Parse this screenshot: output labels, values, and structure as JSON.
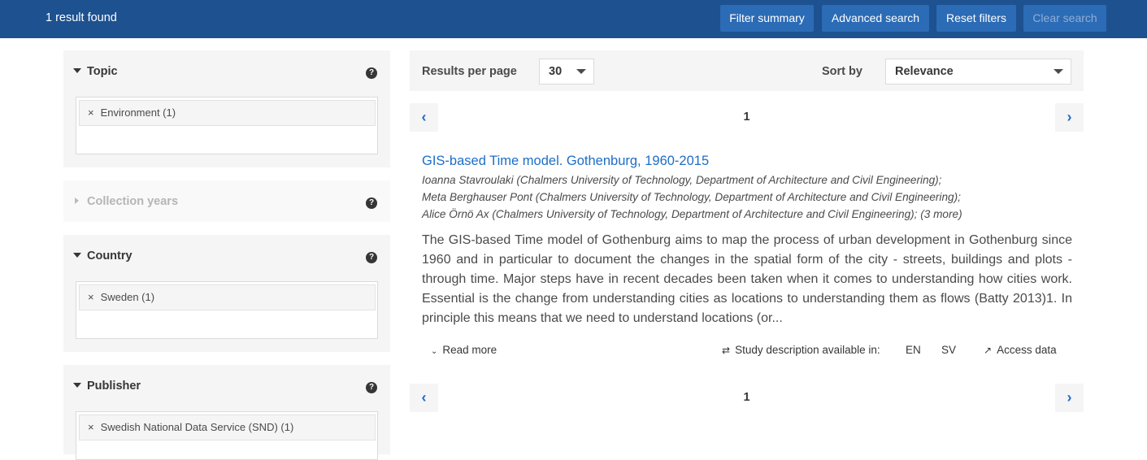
{
  "header": {
    "result_count": "1 result found",
    "buttons": {
      "filter_summary": "Filter summary",
      "advanced_search": "Advanced search",
      "reset_filters": "Reset filters",
      "clear_search": "Clear search"
    }
  },
  "filters": {
    "help_icon": "?",
    "remove_icon": "×",
    "topic": {
      "title": "Topic",
      "selected": "Environment (1)"
    },
    "collection_years": {
      "title": "Collection years"
    },
    "country": {
      "title": "Country",
      "selected": "Sweden (1)"
    },
    "publisher": {
      "title": "Publisher",
      "selected": "Swedish National Data Service (SND) (1)"
    }
  },
  "toolbar": {
    "results_per_page_label": "Results per page",
    "results_per_page_value": "30",
    "sort_by_label": "Sort by",
    "sort_by_value": "Relevance"
  },
  "pagination": {
    "prev_icon": "‹",
    "next_icon": "›",
    "current_page": "1"
  },
  "result": {
    "title": "GIS-based Time model. Gothenburg, 1960-2015",
    "authors": [
      "Ioanna Stavroulaki (Chalmers University of Technology, Department of Architecture and Civil Engineering);",
      "Meta Berghauser Pont (Chalmers University of Technology, Department of Architecture and Civil Engineering);",
      "Alice Örnö Ax (Chalmers University of Technology, Department of Architecture and Civil Engineering); (3 more)"
    ],
    "abstract": "The GIS-based Time model of Gothenburg aims to map the process of urban development in Gothenburg since 1960 and in particular to document the changes in the spatial form of the city - streets, buildings and plots - through time. Major steps have in recent decades been taken when it comes to understanding how cities work. Essential is the change from understanding cities as locations to understanding them as flows (Batty 2013)1. In principle this means that we need to understand locations (or...",
    "read_more": "Read more",
    "available_in_label": "Study description available in:",
    "languages": [
      "EN",
      "SV"
    ],
    "access_data": "Access data"
  },
  "colors": {
    "header_bg": "#1d5190",
    "button_bg": "#2c6bb5",
    "link": "#1d6dc8",
    "panel_bg": "#f5f5f5"
  }
}
